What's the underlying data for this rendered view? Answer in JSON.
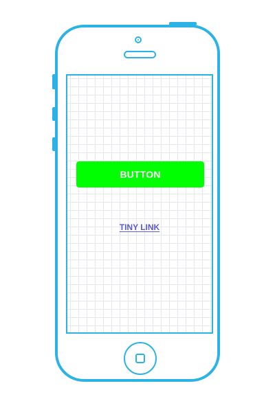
{
  "screen": {
    "primary_button_label": "BUTTON",
    "link_label": "TINY LINK"
  },
  "colors": {
    "device_outline": "#2bb3e6",
    "button_background": "#00ff00",
    "button_text": "#ffffff",
    "link_text": "#5b5bd6",
    "grid_line": "#e5e7ea"
  },
  "icons": {
    "camera": "camera-icon",
    "speaker": "speaker-icon",
    "home_button": "home-button-icon"
  }
}
